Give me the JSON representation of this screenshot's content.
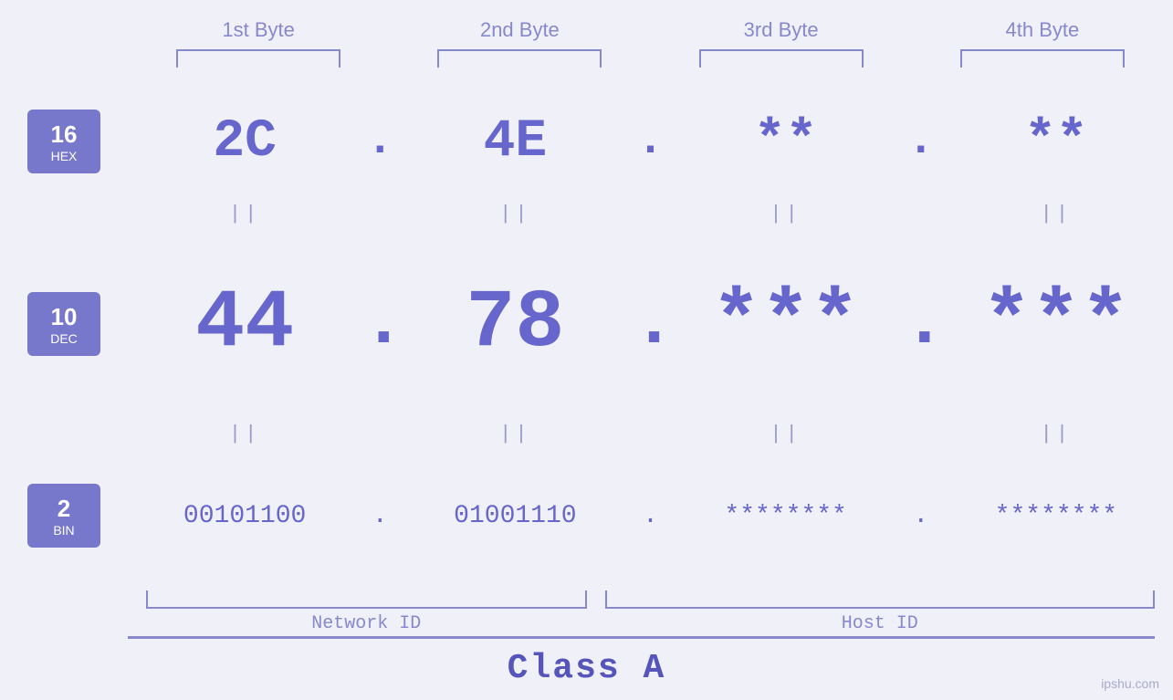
{
  "byteLabels": [
    "1st Byte",
    "2nd Byte",
    "3rd Byte",
    "4th Byte"
  ],
  "bases": [
    {
      "num": "16",
      "label": "HEX",
      "values": [
        "2C",
        "4E",
        "**",
        "**"
      ],
      "dotSize": "hex"
    },
    {
      "num": "10",
      "label": "DEC",
      "values": [
        "44",
        "78",
        "***",
        "***"
      ],
      "dotSize": "dec"
    },
    {
      "num": "2",
      "label": "BIN",
      "values": [
        "00101100",
        "01001110",
        "********",
        "********"
      ],
      "dotSize": "bin"
    }
  ],
  "equals": "||",
  "networkId": "Network ID",
  "hostId": "Host ID",
  "classLabel": "Class A",
  "watermark": "ipshu.com"
}
